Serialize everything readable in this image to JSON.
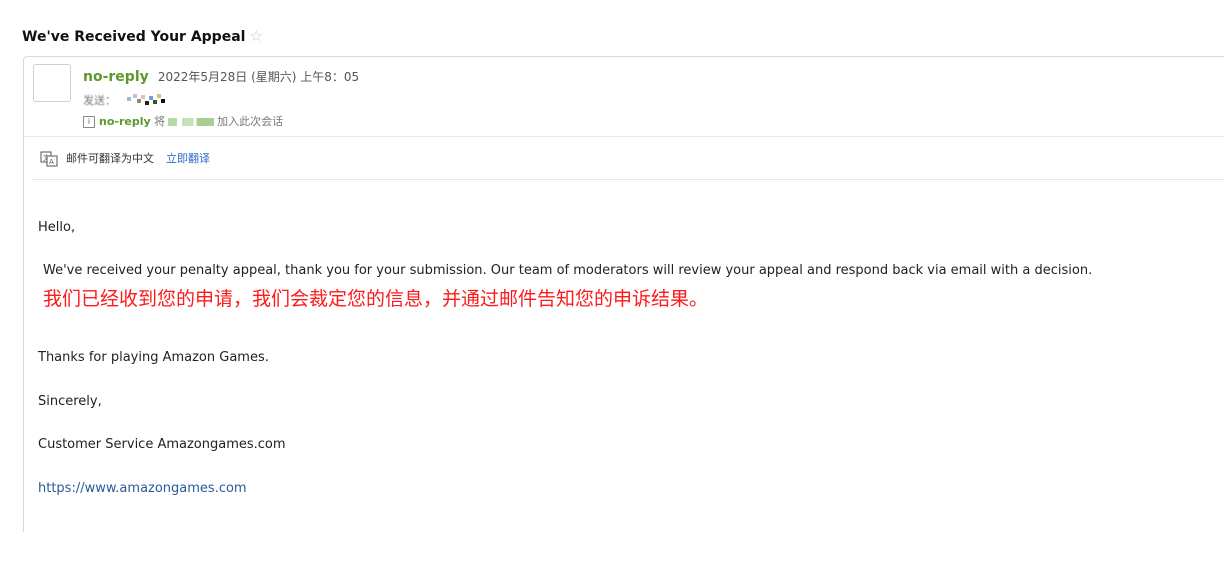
{
  "subject": "We've Received Your Appeal",
  "star_icon": "☆",
  "header": {
    "sender": "no-reply",
    "sent_time": "2022年5月28日 (星期六) 上午8：05",
    "to_label": "发送：",
    "notice": {
      "sender": "no-reply",
      "prefix": "将",
      "suffix": "加入此次会话"
    }
  },
  "translate_bar": {
    "text": "邮件可翻译为中文",
    "action": "立即翻译"
  },
  "body": {
    "greeting": "Hello,",
    "paragraph": "We've received your penalty appeal, thank you for your submission. Our team of moderators will review your appeal and respond back via email with a decision.",
    "annotation": "我们已经收到您的申请，我们会裁定您的信息，并通过邮件告知您的申诉结果。",
    "thanks": "Thanks for playing Amazon Games.",
    "closing": "Sincerely,",
    "signature": "Customer Service Amazongames.com",
    "link": "https://www.amazongames.com"
  },
  "colors": {
    "sender": "#5b9a2a",
    "link": "#2a6cc7",
    "annotation": "#ff1a1a"
  }
}
